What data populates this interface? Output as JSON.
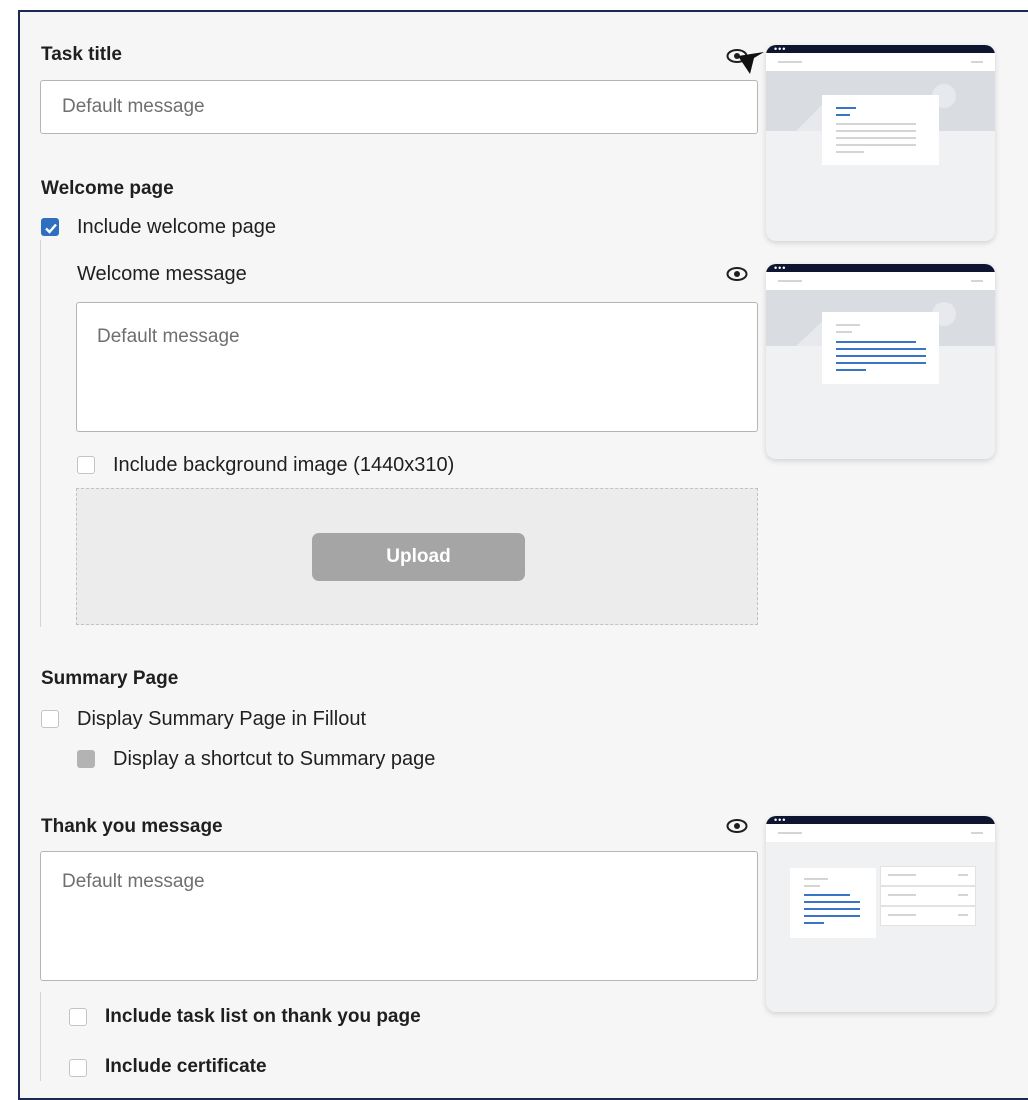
{
  "task_title": {
    "heading": "Task title",
    "placeholder": "Default message"
  },
  "welcome_page": {
    "heading": "Welcome page",
    "include_label": "Include welcome page",
    "include_checked": true,
    "message_label": "Welcome message",
    "message_placeholder": "Default message",
    "bg_image_label": "Include background image (1440x310)",
    "bg_image_checked": false,
    "upload_label": "Upload"
  },
  "summary_page": {
    "heading": "Summary Page",
    "display_label": "Display Summary Page in Fillout",
    "display_checked": false,
    "shortcut_label": "Display a shortcut to Summary page",
    "shortcut_disabled": true
  },
  "thank_you": {
    "heading": "Thank you message",
    "placeholder": "Default message",
    "task_list_label": "Include task list on thank you page",
    "certificate_label": "Include certificate"
  },
  "colors": {
    "accent": "#2f6fc0",
    "frame_border": "#1b2a55",
    "preview_topbar": "#0e1530",
    "upload_disabled": "#a5a5a5"
  },
  "icons": [
    "eye-icon",
    "cursor-icon",
    "checkmark-icon"
  ]
}
